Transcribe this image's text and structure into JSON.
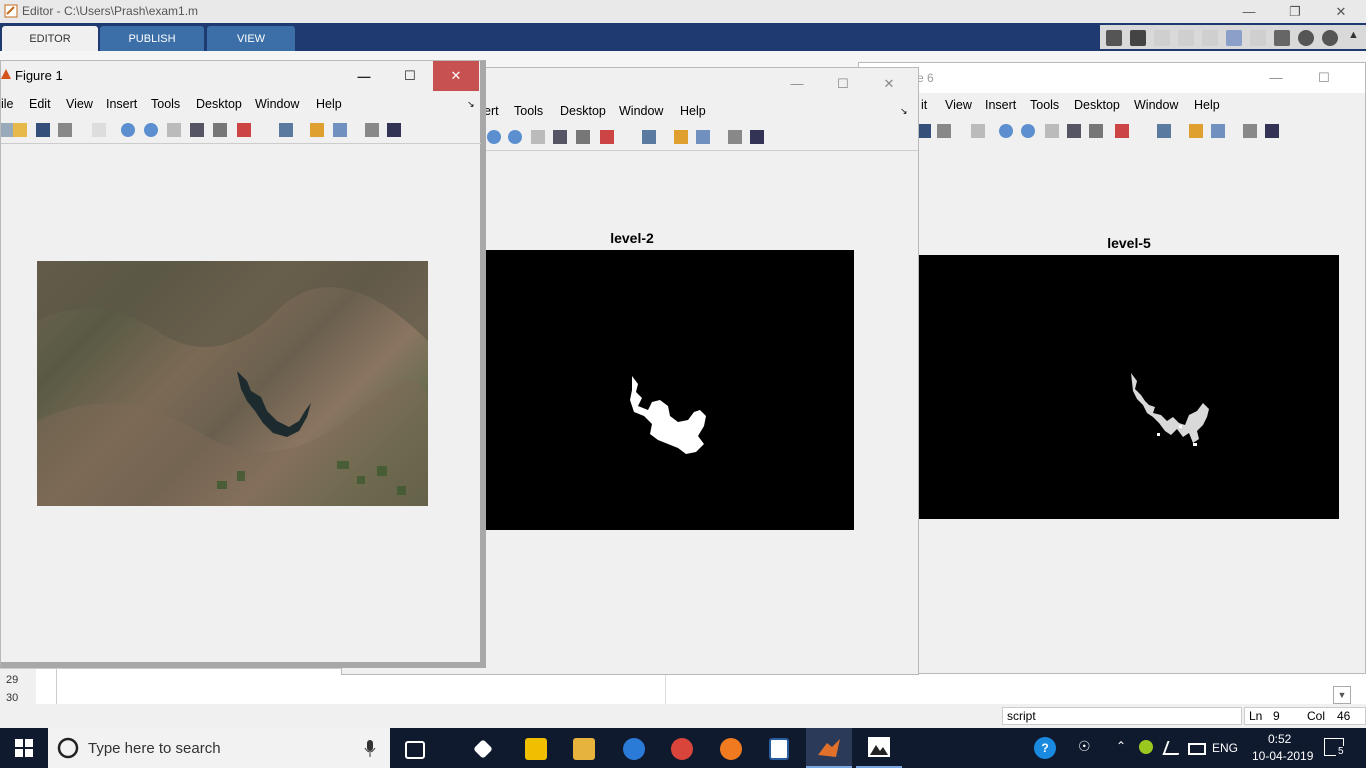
{
  "editor": {
    "title": "Editor - C:\\Users\\Prash\\exam1.m",
    "tabs": [
      "EDITOR",
      "PUBLISH",
      "VIEW"
    ],
    "line_numbers": [
      "29",
      "30"
    ],
    "status": {
      "mode": "script",
      "ln_label": "Ln",
      "ln_value": "9",
      "col_label": "Col",
      "col_value": "46"
    }
  },
  "figure1": {
    "title": "Figure 1",
    "menu": [
      "ile",
      "Edit",
      "View",
      "Insert",
      "Tools",
      "Desktop",
      "Window",
      "Help"
    ]
  },
  "figure2": {
    "menu": [
      "ert",
      "Tools",
      "Desktop",
      "Window",
      "Help"
    ],
    "plot_title": "level-2"
  },
  "figure6": {
    "title_fragment": "e 6",
    "menu": [
      "it",
      "View",
      "Insert",
      "Tools",
      "Desktop",
      "Window",
      "Help"
    ],
    "plot_title": "level-5"
  },
  "taskbar": {
    "search_placeholder": "Type here to search",
    "language": "ENG",
    "time": "0:52",
    "date": "10-04-2019",
    "notification_count": "5"
  },
  "colors": {
    "ribbon": "#1e3a70",
    "taskbar": "#0f1a2e",
    "close_red": "#c75050"
  }
}
